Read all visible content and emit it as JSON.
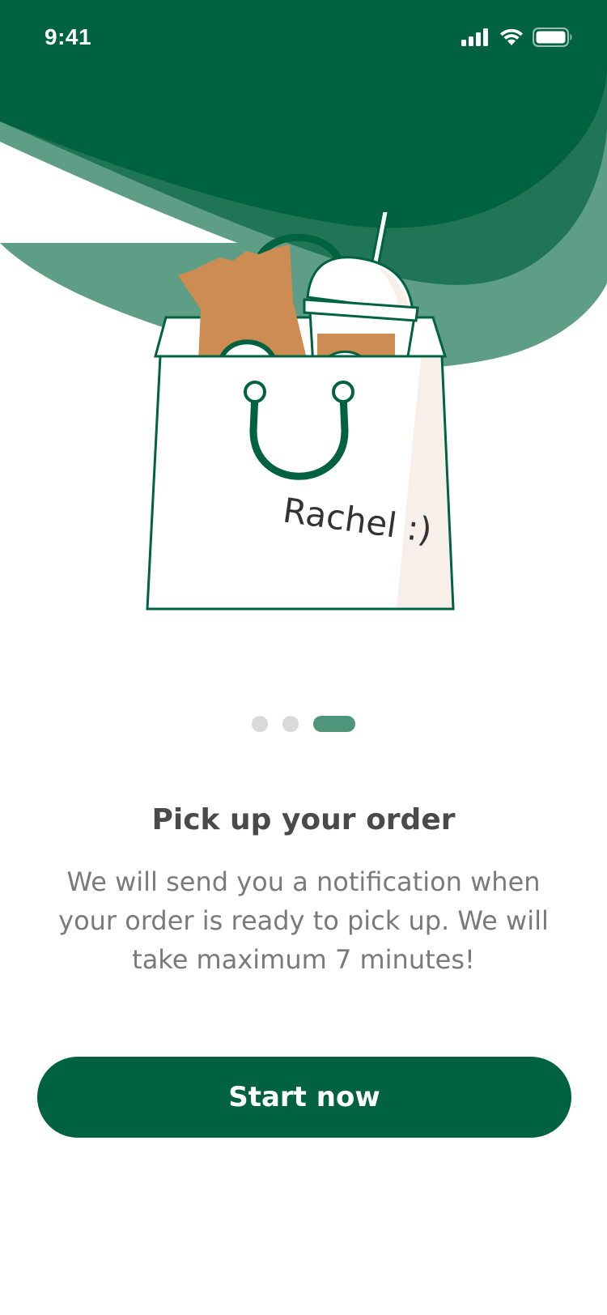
{
  "status_bar": {
    "time": "9:41",
    "signal_icon": "cellular-signal-icon",
    "wifi_icon": "wifi-icon",
    "battery_icon": "battery-icon"
  },
  "illustration": {
    "icon": "shopping-bag-illustration",
    "handwritten_name": "Rachel :)"
  },
  "pager": {
    "total_pages": 3,
    "current_page": 3
  },
  "onboarding": {
    "title": "Pick up your order",
    "description": "We will send you a notification when your order is ready to pick up. We will take maximum 7 minutes!"
  },
  "actions": {
    "start_label": "Start now"
  },
  "colors": {
    "brand_dark_green": "#006241",
    "mid_green": "#1f7555",
    "light_green": "#5f9e86",
    "pager_active": "#4f957b",
    "pager_inactive": "#d9d9d9",
    "kraft_brown": "#cd8c52",
    "cream": "#f9efe9"
  }
}
